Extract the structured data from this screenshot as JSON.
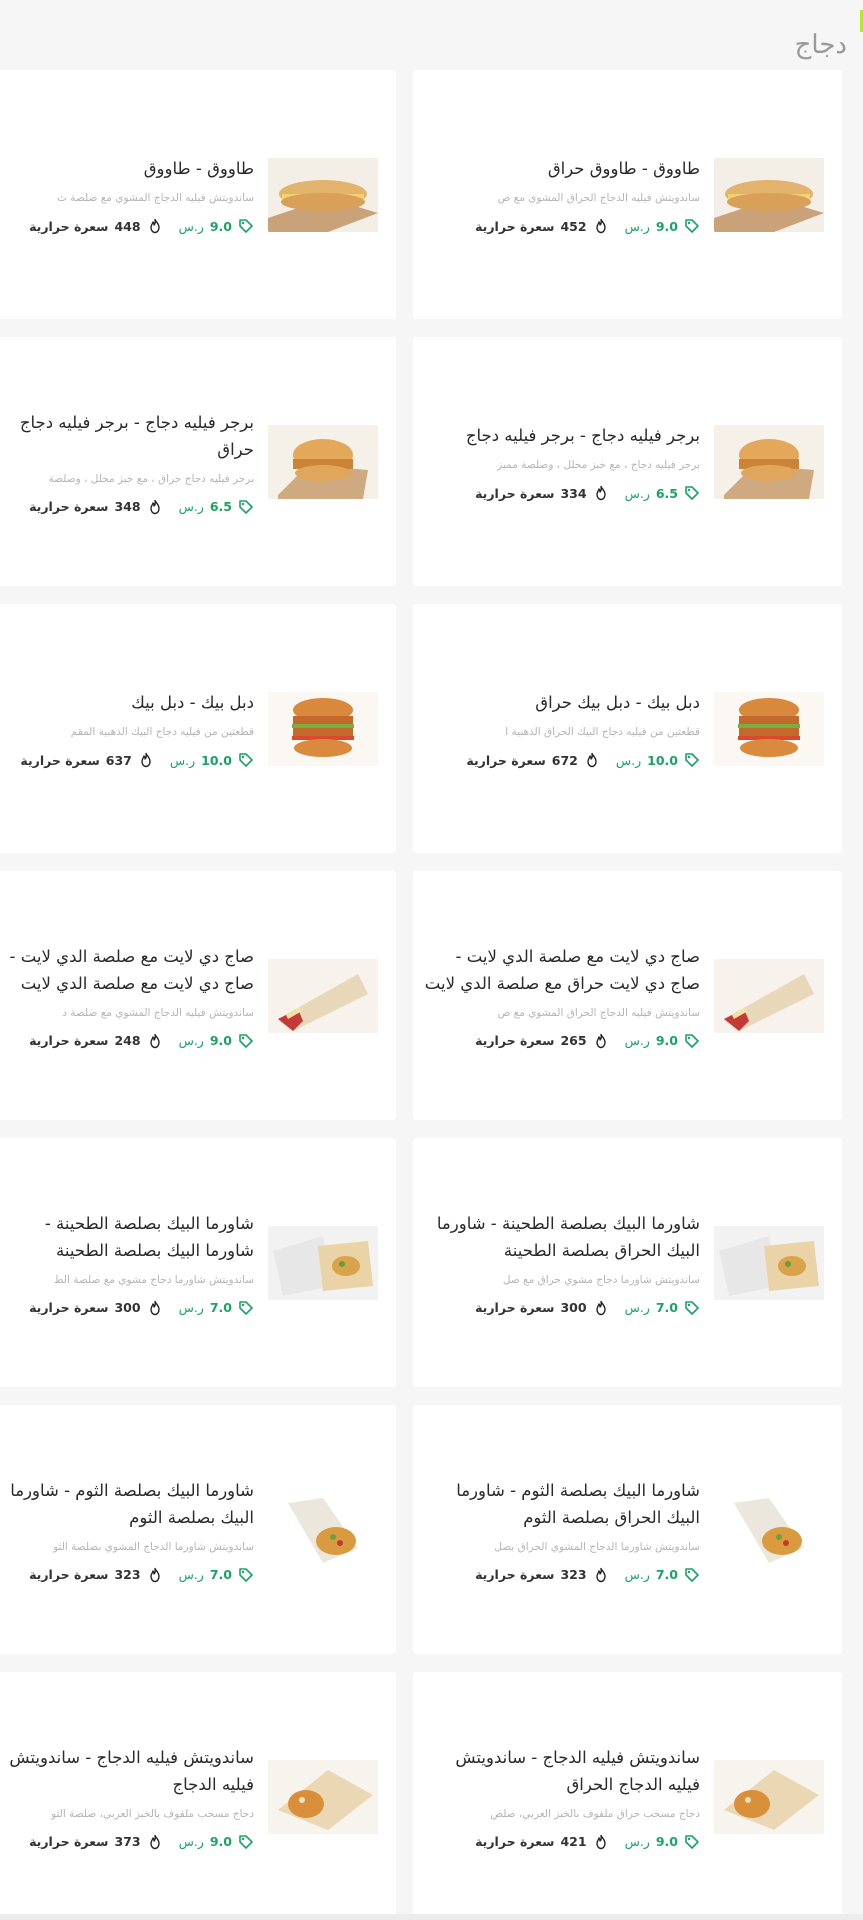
{
  "section": {
    "title": "دجاج"
  },
  "currency": "ر.س",
  "calorie_label": "سعرة حرارية",
  "colors": {
    "price": "#1aa363",
    "accent": "#b9e43a"
  },
  "items": [
    {
      "name": "طاووق - طاووق حراق",
      "desc": "ساندويتش فيليه الدجاج الحراق المشوي مع ص",
      "price": "9.0",
      "calories": "452",
      "image": "sub-sandwich"
    },
    {
      "name": "طاووق - طاووق",
      "desc": "ساندويتش فيليه الدجاج المشوي مع صلصة ث",
      "price": "9.0",
      "calories": "448",
      "image": "sub-sandwich"
    },
    {
      "name": "برجر فيليه دجاج - برجر فيليه دجاج",
      "desc": "برجر فيليه دجاج ، مع خبز مخلل ، وصلصة مميز",
      "price": "6.5",
      "calories": "334",
      "image": "chicken-burger"
    },
    {
      "name": "برجر فيليه دجاج - برجر فيليه دجاج حراق",
      "desc": "برجر فيليه دجاج حراق ، مع خبز مخلل ، وصلصة",
      "price": "6.5",
      "calories": "348",
      "image": "chicken-burger"
    },
    {
      "name": "دبل بيك - دبل بيك حراق",
      "desc": "قطعتين من فيليه دجاج البيك الحراق الذهبية ا",
      "price": "10.0",
      "calories": "672",
      "image": "double-burger"
    },
    {
      "name": "دبل بيك - دبل بيك",
      "desc": "قطعتين من فيليه دجاج البيك الذهبية المقم",
      "price": "10.0",
      "calories": "637",
      "image": "double-burger"
    },
    {
      "name": "صاج دي لايت مع صلصة الدي لايت - صاج دي لايت حراق مع صلصة الدي لايت",
      "desc": "ساندويتش فيليه الدجاج الحراق المشوي مع ص",
      "price": "9.0",
      "calories": "265",
      "image": "saj-wrap"
    },
    {
      "name": "صاج دي لايت مع صلصة الدي لايت - صاج دي لايت مع صلصة الدي لايت",
      "desc": "ساندويتش فيليه الدجاج المشوي مع صلصة د",
      "price": "9.0",
      "calories": "248",
      "image": "saj-wrap"
    },
    {
      "name": "شاورما البيك بصلصة الطحينة - شاورما البيك الحراق بصلصة الطحينة",
      "desc": "ساندويتش شاورما دجاج مشوي حراق مع صل",
      "price": "7.0",
      "calories": "300",
      "image": "shawarma-paper"
    },
    {
      "name": "شاورما البيك بصلصة الطحينة - شاورما البيك بصلصة الطحينة",
      "desc": "ساندويتش شاورما دجاج مشوي مع صلصة الط",
      "price": "7.0",
      "calories": "300",
      "image": "shawarma-paper"
    },
    {
      "name": "شاورما البيك بصلصة الثوم - شاورما البيك الحراق بصلصة الثوم",
      "desc": "ساندويتش شاورما الدجاج المشوي الحراق بصل",
      "price": "7.0",
      "calories": "323",
      "image": "shawarma-garlic"
    },
    {
      "name": "شاورما البيك بصلصة الثوم - شاورما البيك بصلصة الثوم",
      "desc": "ساندويتش شاورما الدجاج المشوي بصلصة الثو",
      "price": "7.0",
      "calories": "323",
      "image": "shawarma-garlic"
    },
    {
      "name": "ساندويتش فيليه الدجاج - ساندويتش فيليه الدجاج الحراق",
      "desc": "دجاج مسحب حراق ملفوف بالخبز العربي، صلص",
      "price": "9.0",
      "calories": "421",
      "image": "fillet-wrap"
    },
    {
      "name": "ساندويتش فيليه الدجاج - ساندويتش فيليه الدجاج",
      "desc": "دجاج مسحب ملفوف بالخبز العربي، صلصة الثو",
      "price": "9.0",
      "calories": "373",
      "image": "fillet-wrap"
    }
  ]
}
